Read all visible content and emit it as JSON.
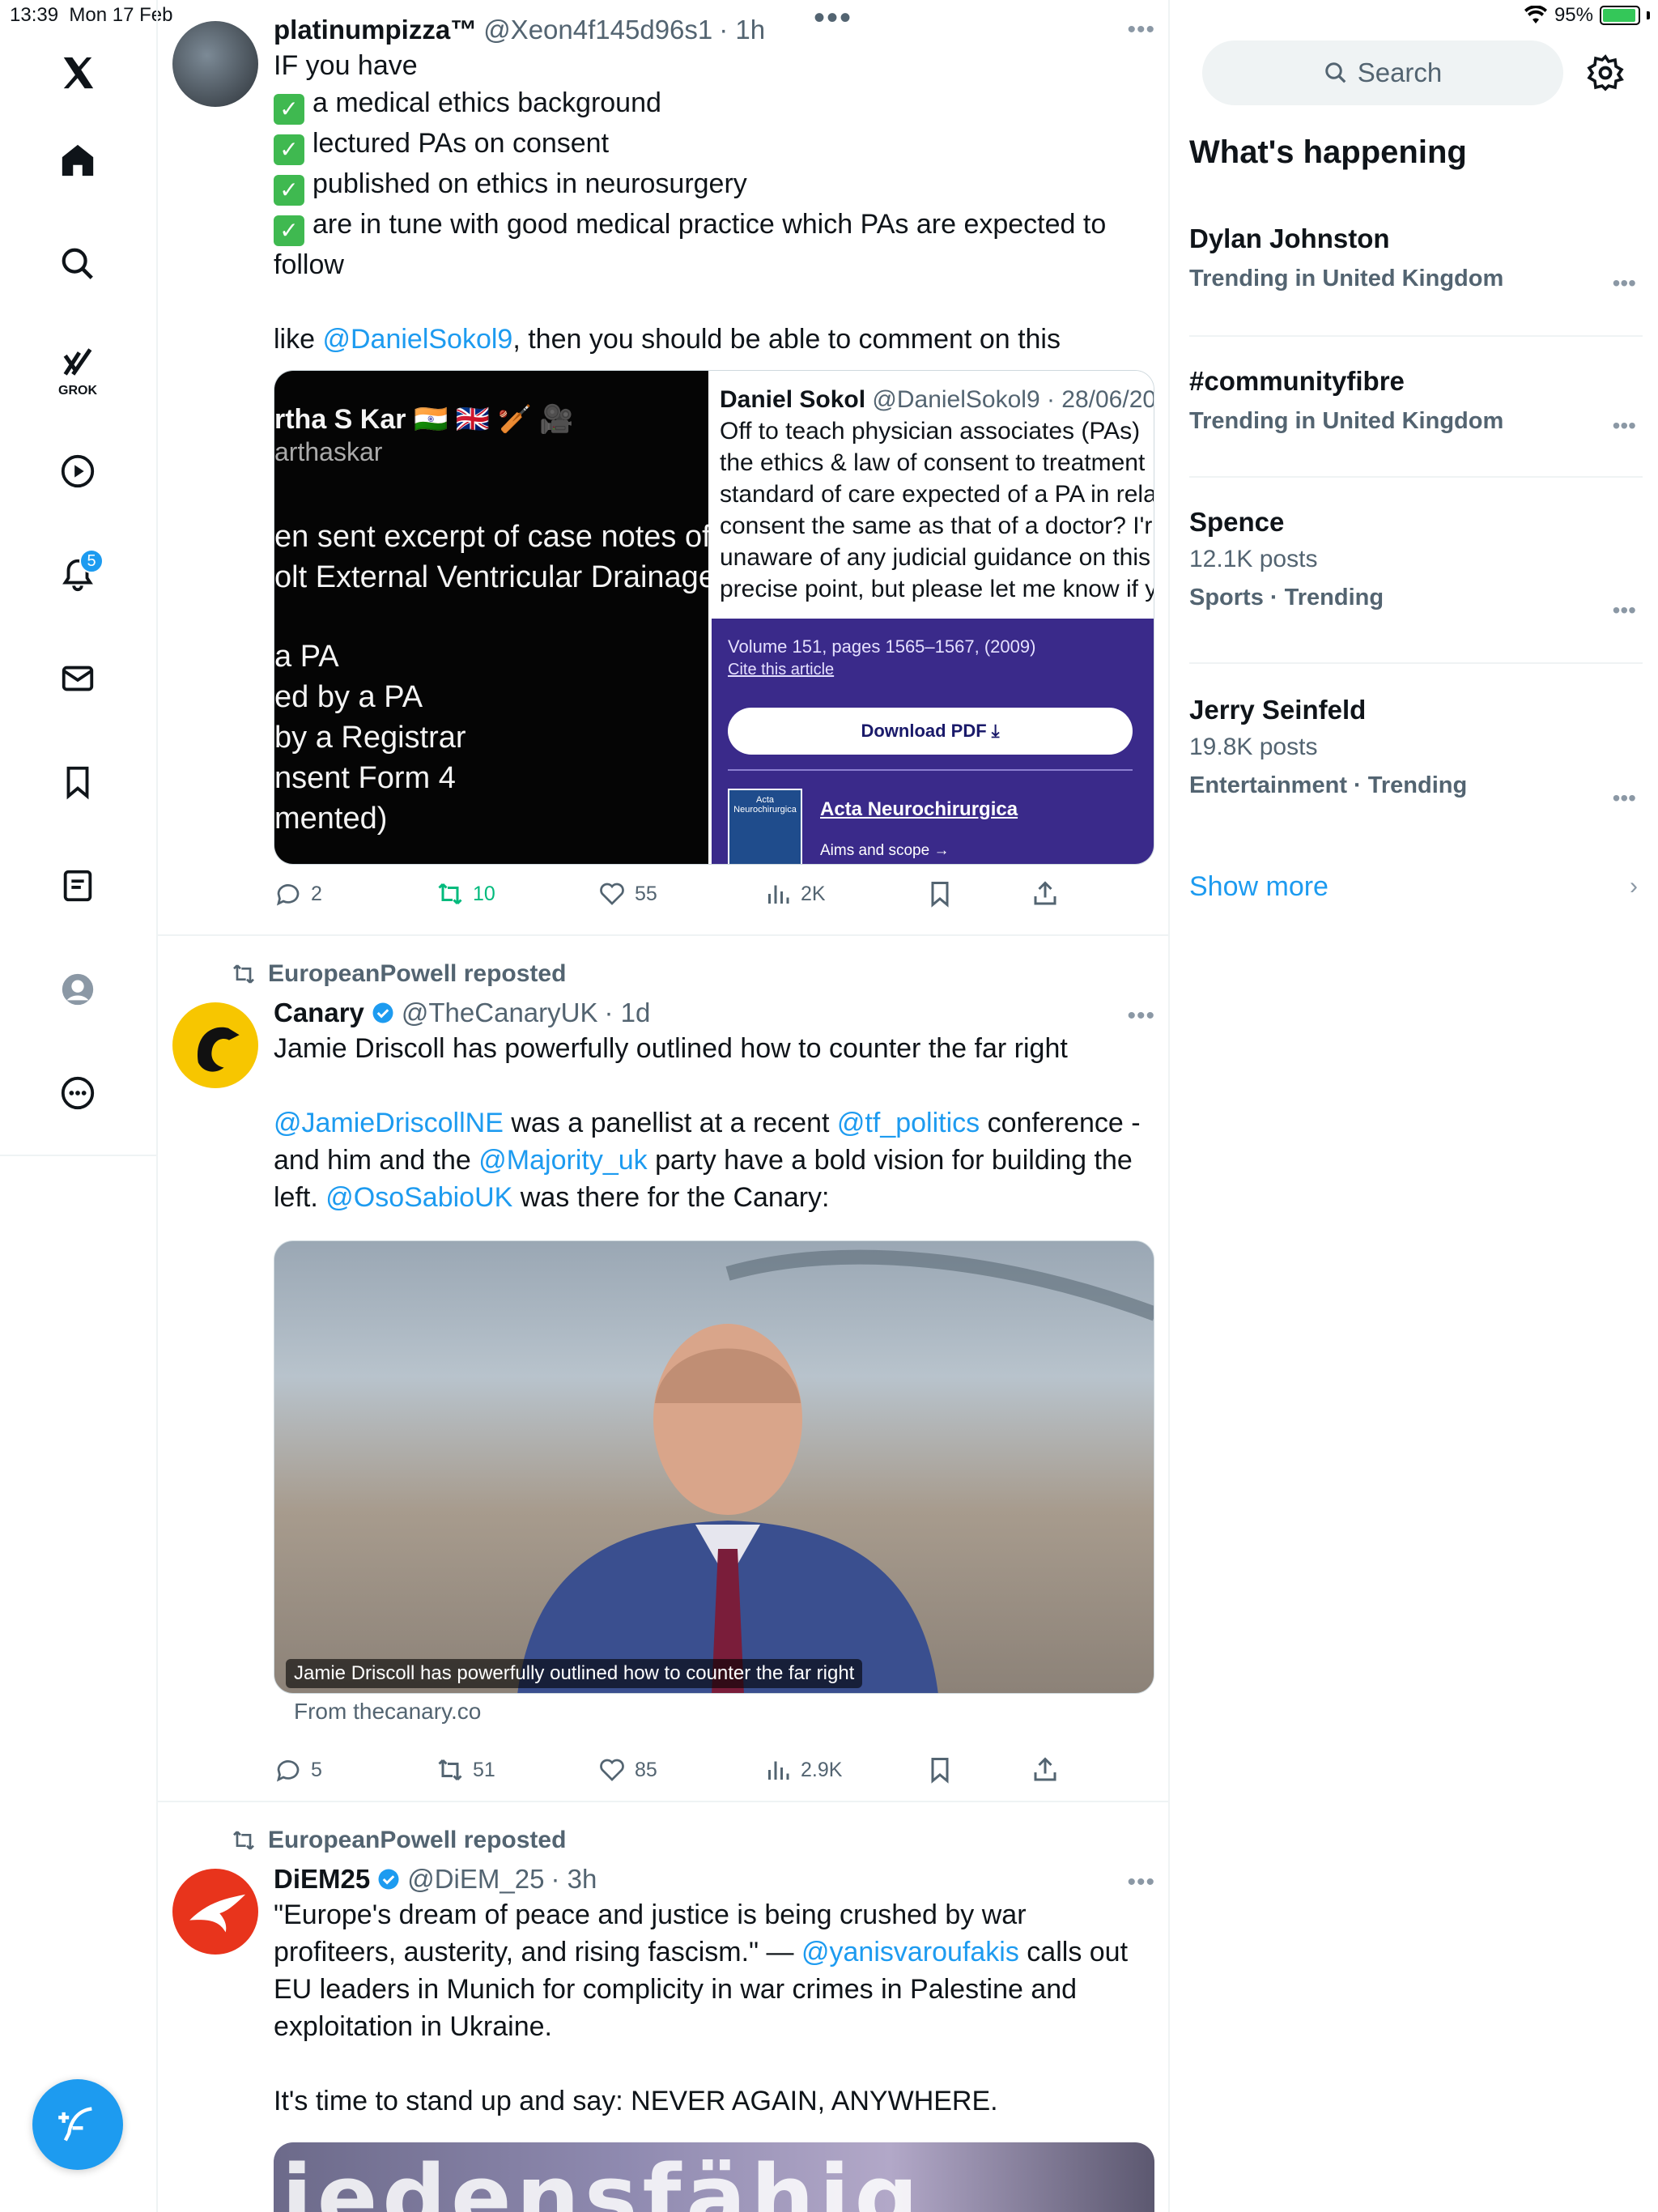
{
  "status": {
    "time": "13:39",
    "date": "Mon 17 Feb",
    "battery": "95%",
    "battery_level": 0.95
  },
  "nav": {
    "grok_label": "GROK",
    "notifications_badge": "5"
  },
  "top_more": "•••",
  "tweet1": {
    "name": "platinumpizza™",
    "handle": "@Xeon4f145d96s1",
    "time": "· 1h",
    "line1": "IF you have",
    "check_items": [
      "a medical ethics background",
      "lectured PAs on consent",
      "published on ethics in neurosurgery",
      "are in tune with good medical practice which PAs are expected to"
    ],
    "line_follow": "follow",
    "like_prefix": "like ",
    "mention": "@DanielSokol9",
    "like_suffix": ", then you should be able to comment on this",
    "media_left": {
      "l1": "rtha S Kar 🇮🇳 🇬🇧 🏏 🎥",
      "l2": "arthaskar",
      "l3": "en sent excerpt of case notes of a",
      "l4": "olt External Ventricular Drainage\"",
      "l5": "a PA",
      "l6": "ed by a PA",
      "l7": "by a Registrar",
      "l8": "nsent Form 4",
      "l9": "mented)"
    },
    "media_right": {
      "name": "Daniel Sokol",
      "handle": "@DanielSokol9 · 28/06/20",
      "l1": "Off to teach physician associates (PAs)",
      "l2": "the ethics & law of consent to treatment",
      "l3": "standard of care expected of a PA in rela",
      "l4": "consent the same as that of a doctor? I'r",
      "l5": "unaware of any judicial guidance on this",
      "l6": "precise point, but please let me know if y",
      "vol": "Volume 151, pages 1565–1567, (2009)",
      "cite": "Cite this article",
      "download": "Download PDF ⤓",
      "cover": "Acta Neurochirurgica",
      "journal": "Acta Neurochirurgica",
      "aims": "Aims and scope →"
    },
    "replies": "2",
    "reposts": "10",
    "likes": "55",
    "views": "2K"
  },
  "tweet2": {
    "reposted_by": "EuropeanPowell reposted",
    "name": "Canary",
    "handle": "@TheCanaryUK",
    "time": "· 1d",
    "p1": "Jamie Driscoll has powerfully outlined how to counter the far right",
    "m1": "@JamieDriscollNE",
    "t1": " was a panellist at a recent ",
    "m2": "@tf_politics",
    "t2": " conference -",
    "t3": "and him and the ",
    "m3": "@Majority_uk",
    "t4": " party have a bold vision for building the",
    "t5": "left. ",
    "m4": "@OsoSabioUK",
    "t6": " was there for the Canary:",
    "caption": "Jamie Driscoll has powerfully outlined how to counter the far right",
    "from": "From thecanary.co",
    "replies": "5",
    "reposts": "51",
    "likes": "85",
    "views": "2.9K"
  },
  "tweet3": {
    "reposted_by": "EuropeanPowell reposted",
    "name": "DiEM25",
    "handle": "@DiEM_25",
    "time": "· 3h",
    "l1": "\"Europe's dream of peace and justice is being crushed by war",
    "l2a": "profiteers, austerity, and rising fascism.\" — ",
    "l2m": "@yanisvaroufakis",
    "l2b": " calls out",
    "l3": "EU leaders in Munich for complicity in war crimes in Palestine and",
    "l4": "exploitation in Ukraine.",
    "l5": "It's time to stand up and say: NEVER AGAIN, ANYWHERE.",
    "image_text": "iedensfähig"
  },
  "sidebar": {
    "search_label": "Search",
    "title": "What's happening",
    "trends": [
      {
        "name": "Dylan Johnston",
        "meta": "Trending in United Kingdom"
      },
      {
        "name": "#communityfibre",
        "meta": "Trending in United Kingdom"
      },
      {
        "name": "Spence",
        "posts": "12.1K posts",
        "meta": "Sports · Trending"
      },
      {
        "name": "Jerry Seinfeld",
        "posts": "19.8K posts",
        "meta": "Entertainment · Trending"
      }
    ],
    "show_more": "Show more"
  },
  "colors": {
    "accent": "#1d9bf0",
    "repost_green": "#00ba7c",
    "muted": "#536471"
  }
}
